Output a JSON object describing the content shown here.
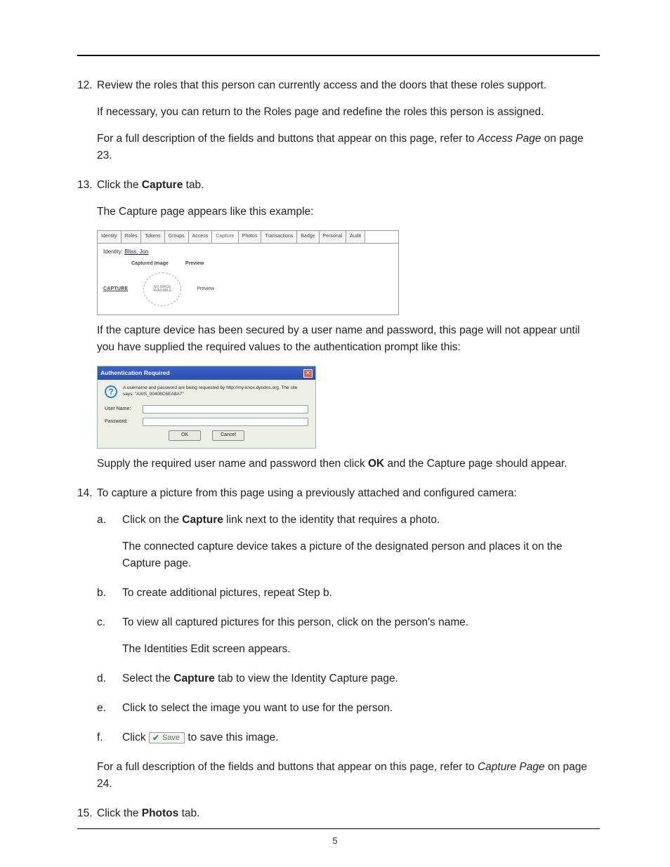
{
  "page_number": "5",
  "items": {
    "n12": {
      "num": "12.",
      "p1": "Review the roles that this person can currently access and the doors that these roles support.",
      "p2": "If necessary, you can return to the Roles page and redefine the roles this person is assigned.",
      "p3a": "For a full description of the fields and buttons that appear on this page, refer to ",
      "p3b_em": "Access Page",
      "p3c": " on page 23."
    },
    "n13": {
      "num": "13.",
      "p1a": "Click the ",
      "p1b_bd": "Capture",
      "p1c": " tab.",
      "p2": "The Capture page appears like this example:",
      "p3": "If the capture device has been secured by a user name and password, this page will not appear until you have supplied the required values to the authentication prompt like this:",
      "p4a": "Supply the required user name and password then click ",
      "p4b_bd": "OK",
      "p4c": " and the Capture page should appear."
    },
    "n14": {
      "num": "14.",
      "p1": "To capture a picture from this page using a previously attached and configured camera:",
      "sub": {
        "a": {
          "letter": "a.",
          "p1a": "Click on the ",
          "p1b_bd": "Capture",
          "p1c": " link next to the identity that requires a photo.",
          "p2": "The connected capture device takes a picture of the designated person and places it on the Capture page."
        },
        "b": {
          "letter": "b.",
          "p1": "To create additional pictures, repeat Step b."
        },
        "c": {
          "letter": "c.",
          "p1": "To view all captured pictures for this person, click on the person's name.",
          "p2": "The Identities Edit screen appears."
        },
        "d": {
          "letter": "d.",
          "p1a": "Select the ",
          "p1b_bd": "Capture",
          "p1c": " tab to view the Identity Capture page."
        },
        "e": {
          "letter": "e.",
          "p1": "Click to select the image you want to use for the person."
        },
        "f": {
          "letter": "f.",
          "p1a": "Click  ",
          "save_label": "Save",
          "p1c": "  to save this image."
        }
      },
      "p_after_a": "For a full description of the fields and buttons that appear on this page, refer to ",
      "p_after_b_em": "Capture Page",
      "p_after_c": " on page 24."
    },
    "n15": {
      "num": "15.",
      "p1a": "Click the ",
      "p1b_bd": "Photos",
      "p1c": " tab."
    }
  },
  "fig_capture": {
    "tabs": [
      "Identity",
      "Roles",
      "Tokens",
      "Groups",
      "Access",
      "Capture",
      "Photos",
      "Transactions",
      "Badge",
      "Personal",
      "Audit"
    ],
    "active_tab_index": 5,
    "identity_label": "Identity:",
    "identity_name": "Bliss, Jon",
    "col1": "Captured Image",
    "col2": "Preview",
    "capture_link": "CAPTURE",
    "noimage": "NO IMAGE AVAILABLE",
    "preview2": "Preview"
  },
  "fig_auth": {
    "title": "Authentication Required",
    "message": "A username and password are being requested by http://my-knox.dyndns.org. The site says: \"AXIS_00408C6EA8A7\"",
    "user_label": "User Name:",
    "pass_label": "Password:",
    "ok": "OK",
    "cancel": "Cancel"
  }
}
